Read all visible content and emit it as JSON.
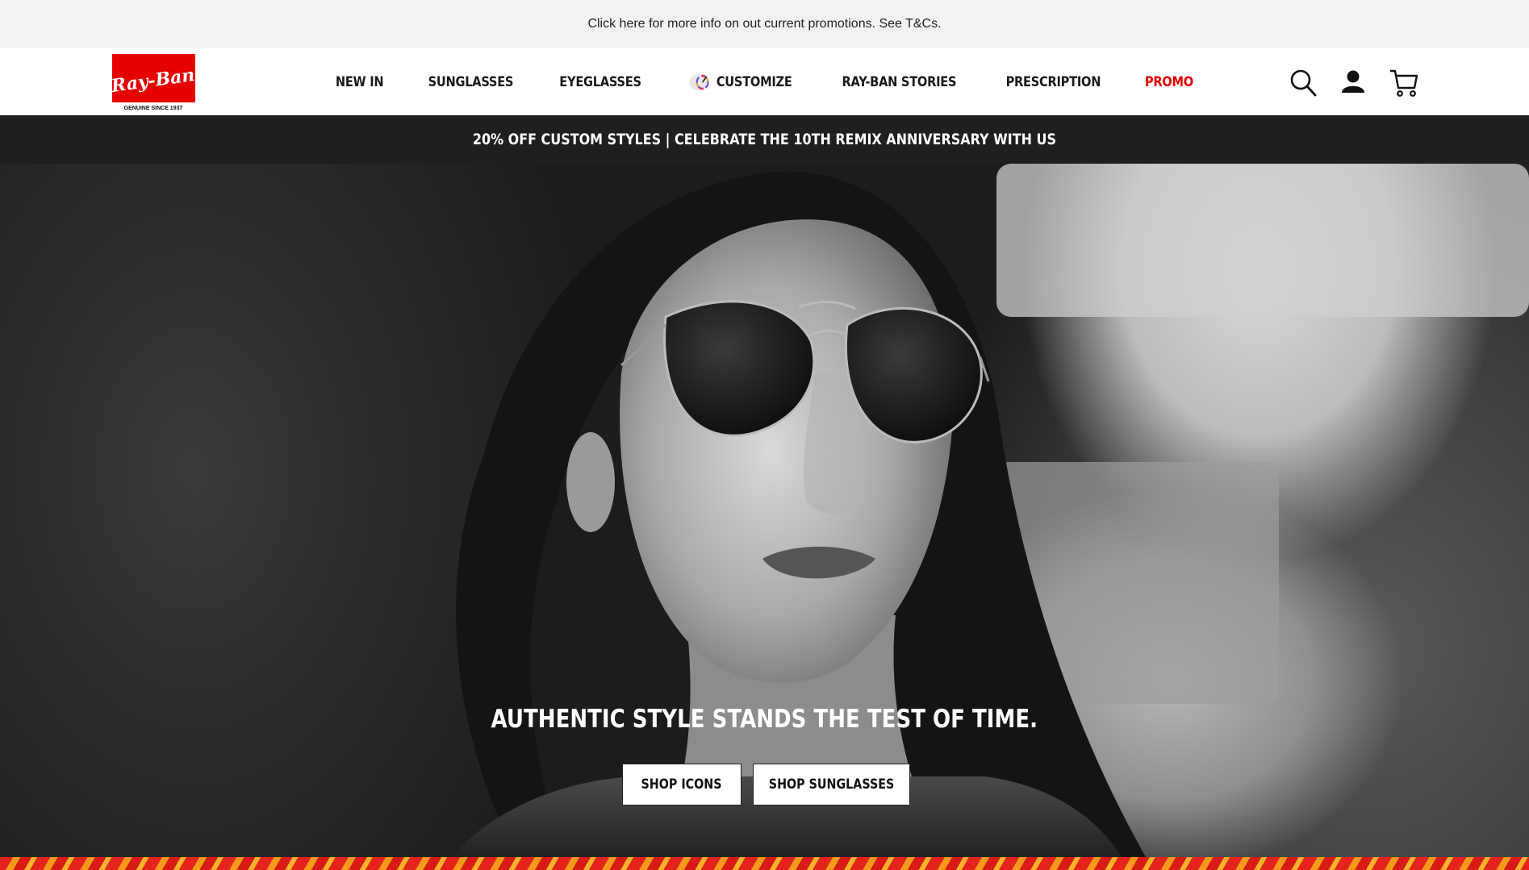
{
  "promo_strip": {
    "text": "Click here for more info on out current promotions. See T&Cs."
  },
  "header": {
    "logo": {
      "brand": "Ray-Ban",
      "tagline": "GENUINE SINCE 1937",
      "color": "#e60000"
    },
    "nav": [
      {
        "label": "NEW IN"
      },
      {
        "label": "SUNGLASSES"
      },
      {
        "label": "EYEGLASSES"
      },
      {
        "label": "CUSTOMIZE",
        "icon": "customize-icon"
      },
      {
        "label": "RAY-BAN STORIES"
      },
      {
        "label": "PRESCRIPTION"
      },
      {
        "label": "PROMO",
        "color": "#e60000"
      }
    ],
    "icons": [
      "search-icon",
      "account-icon",
      "cart-icon"
    ]
  },
  "announcement": {
    "text": "20% OFF CUSTOM STYLES | CELEBRATE THE 10TH REMIX ANNIVERSARY WITH US"
  },
  "hero": {
    "title": "AUTHENTIC STYLE STANDS THE TEST OF TIME.",
    "buttons": [
      {
        "label": "SHOP ICONS"
      },
      {
        "label": "SHOP SUNGLASSES"
      }
    ]
  }
}
